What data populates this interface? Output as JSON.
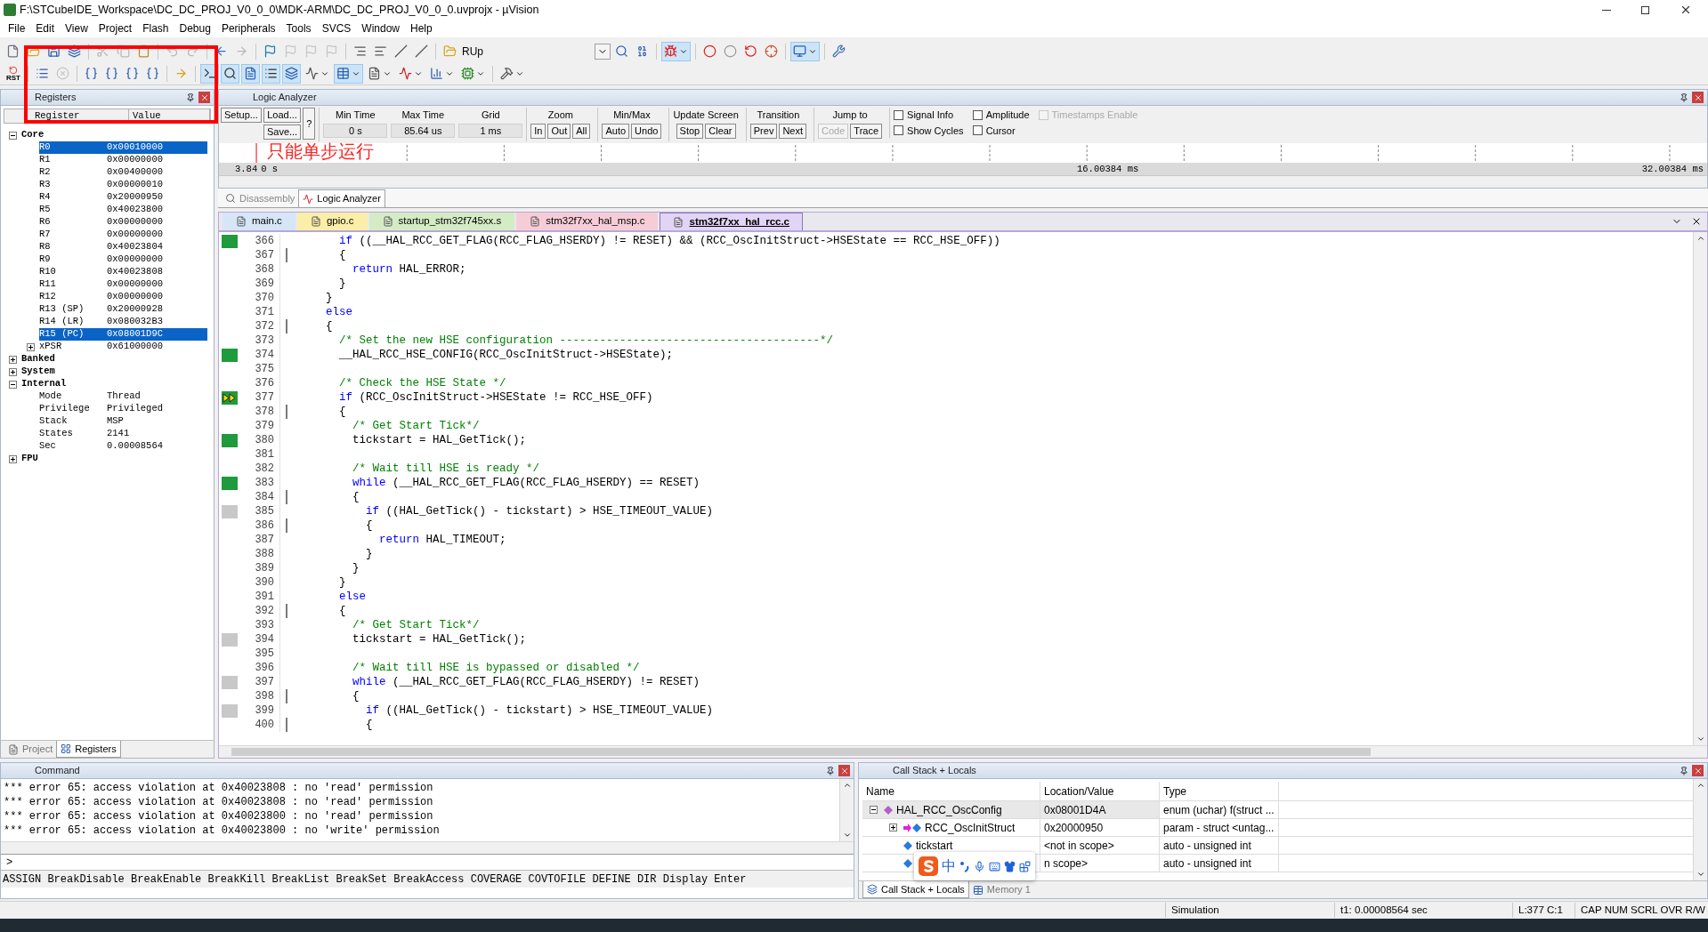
{
  "window": {
    "title": "F:\\STCubeIDE_Workspace\\DC_DC_PROJ_V0_0_0\\MDK-ARM\\DC_DC_PROJ_V0_0_0.uvprojx - µVision"
  },
  "menu": [
    "File",
    "Edit",
    "View",
    "Project",
    "Flash",
    "Debug",
    "Peripherals",
    "Tools",
    "SVCS",
    "Window",
    "Help"
  ],
  "toolbar_1": [
    {
      "kind": "button",
      "selected": false,
      "disabled": false
    },
    {
      "kind": "button",
      "selected": false,
      "disabled": false
    },
    {
      "kind": "button",
      "selected": false,
      "disabled": false
    },
    {
      "kind": "button",
      "selected": false,
      "disabled": false
    },
    {
      "kind": "separator"
    },
    {
      "kind": "button",
      "selected": false,
      "disabled": true
    },
    {
      "kind": "button",
      "selected": false,
      "disabled": true
    },
    {
      "kind": "button",
      "selected": false,
      "disabled": false
    },
    {
      "kind": "separator"
    },
    {
      "kind": "button",
      "selected": false,
      "disabled": true
    },
    {
      "kind": "button",
      "selected": false,
      "disabled": true
    },
    {
      "kind": "separator"
    },
    {
      "kind": "button",
      "selected": false,
      "disabled": false
    },
    {
      "kind": "button",
      "selected": false,
      "disabled": true
    },
    {
      "kind": "separator"
    },
    {
      "kind": "button",
      "selected": false,
      "disabled": false
    },
    {
      "kind": "button",
      "selected": false,
      "disabled": true
    },
    {
      "kind": "button",
      "selected": false,
      "disabled": true
    },
    {
      "kind": "button",
      "selected": false,
      "disabled": true
    },
    {
      "kind": "separator"
    },
    {
      "kind": "button",
      "selected": false,
      "disabled": false
    },
    {
      "kind": "button",
      "selected": false,
      "disabled": false
    },
    {
      "kind": "button",
      "selected": false,
      "disabled": false
    },
    {
      "kind": "button",
      "selected": false,
      "disabled": false
    },
    {
      "kind": "separator"
    },
    {
      "kind": "button",
      "selected": false,
      "disabled": false,
      "label": "RUp"
    },
    {
      "kind": "combo"
    },
    {
      "kind": "button",
      "selected": false,
      "disabled": false
    },
    {
      "kind": "button",
      "selected": false,
      "disabled": false
    },
    {
      "kind": "separator"
    },
    {
      "kind": "split",
      "selected": true,
      "disabled": false
    },
    {
      "kind": "separator"
    },
    {
      "kind": "button",
      "selected": false,
      "disabled": false
    },
    {
      "kind": "button",
      "selected": false,
      "disabled": false
    },
    {
      "kind": "button",
      "selected": false,
      "disabled": false
    },
    {
      "kind": "button",
      "selected": false,
      "disabled": false
    },
    {
      "kind": "separator"
    },
    {
      "kind": "split",
      "selected": true,
      "disabled": false
    },
    {
      "kind": "separator"
    },
    {
      "kind": "button",
      "selected": false,
      "disabled": false
    }
  ],
  "toolbar_2": [
    {
      "kind": "button",
      "selected": false,
      "disabled": false,
      "label": "RST"
    },
    {
      "kind": "separator"
    },
    {
      "kind": "button",
      "selected": false,
      "disabled": false
    },
    {
      "kind": "button",
      "selected": false,
      "disabled": true
    },
    {
      "kind": "separator"
    },
    {
      "kind": "button",
      "selected": false,
      "disabled": false
    },
    {
      "kind": "button",
      "selected": false,
      "disabled": false
    },
    {
      "kind": "button",
      "selected": false,
      "disabled": false
    },
    {
      "kind": "button",
      "selected": false,
      "disabled": false
    },
    {
      "kind": "separator"
    },
    {
      "kind": "button",
      "selected": false,
      "disabled": false
    },
    {
      "kind": "separator"
    },
    {
      "kind": "button",
      "selected": true,
      "disabled": false
    },
    {
      "kind": "button",
      "selected": true,
      "disabled": false
    },
    {
      "kind": "button",
      "selected": true,
      "disabled": false
    },
    {
      "kind": "button",
      "selected": true,
      "disabled": false
    },
    {
      "kind": "button",
      "selected": true,
      "disabled": false
    },
    {
      "kind": "split",
      "selected": false,
      "disabled": false
    },
    {
      "kind": "split",
      "selected": true,
      "disabled": false
    },
    {
      "kind": "split",
      "selected": false,
      "disabled": false
    },
    {
      "kind": "split",
      "selected": false,
      "disabled": false
    },
    {
      "kind": "split",
      "selected": false,
      "disabled": false
    },
    {
      "kind": "split",
      "selected": false,
      "disabled": false
    },
    {
      "kind": "separator"
    },
    {
      "kind": "split",
      "selected": false,
      "disabled": false
    }
  ],
  "registers_panel": {
    "title": "Registers",
    "columns": [
      "Register",
      "Value"
    ],
    "tree": [
      {
        "name": "Core",
        "expanded": true,
        "selected": false,
        "children": [
          {
            "name": "R0",
            "value": "0x00010000",
            "selected": true
          },
          {
            "name": "R1",
            "value": "0x00000000",
            "selected": false
          },
          {
            "name": "R2",
            "value": "0x00400000",
            "selected": false
          },
          {
            "name": "R3",
            "value": "0x00000010",
            "selected": false
          },
          {
            "name": "R4",
            "value": "0x20000950",
            "selected": false
          },
          {
            "name": "R5",
            "value": "0x40023800",
            "selected": false
          },
          {
            "name": "R6",
            "value": "0x00000000",
            "selected": false
          },
          {
            "name": "R7",
            "value": "0x00000000",
            "selected": false
          },
          {
            "name": "R8",
            "value": "0x40023804",
            "selected": false
          },
          {
            "name": "R9",
            "value": "0x00000000",
            "selected": false
          },
          {
            "name": "R10",
            "value": "0x40023808",
            "selected": false
          },
          {
            "name": "R11",
            "value": "0x00000000",
            "selected": false
          },
          {
            "name": "R12",
            "value": "0x00000000",
            "selected": false
          },
          {
            "name": "R13 (SP)",
            "value": "0x20000928",
            "selected": false
          },
          {
            "name": "R14 (LR)",
            "value": "0x080032B3",
            "selected": false
          },
          {
            "name": "R15 (PC)",
            "value": "0x08001D9C",
            "selected": true
          },
          {
            "name": "xPSR",
            "value": "0x61000000",
            "expanded": false,
            "selected": false
          }
        ]
      },
      {
        "name": "Banked",
        "expanded": false,
        "selected": false
      },
      {
        "name": "System",
        "expanded": false,
        "selected": false
      },
      {
        "name": "Internal",
        "expanded": true,
        "selected": false,
        "children": [
          {
            "name": "Mode",
            "value": "Thread",
            "selected": false
          },
          {
            "name": "Privilege",
            "value": "Privileged",
            "selected": false
          },
          {
            "name": "Stack",
            "value": "MSP",
            "selected": false
          },
          {
            "name": "States",
            "value": "2141",
            "selected": false
          },
          {
            "name": "Sec",
            "value": "0.00008564",
            "selected": false
          }
        ]
      },
      {
        "name": "FPU",
        "expanded": false,
        "selected": false
      }
    ],
    "tabs": [
      {
        "label": "Project",
        "selected": false
      },
      {
        "label": "Registers",
        "selected": true
      }
    ]
  },
  "logic_analyzer": {
    "title": "Logic Analyzer",
    "setup_buttons": [
      "Setup...",
      "Load...",
      "Save...",
      "?"
    ],
    "fields": [
      {
        "label": "Min Time",
        "value": "0 s"
      },
      {
        "label": "Max Time",
        "value": "85.64 us"
      },
      {
        "label": "Grid",
        "value": "1 ms"
      }
    ],
    "groups": [
      {
        "label": "Zoom",
        "buttons": [
          {
            "label": "In",
            "disabled": false
          },
          {
            "label": "Out",
            "disabled": false
          },
          {
            "label": "All",
            "disabled": false
          }
        ]
      },
      {
        "label": "Min/Max",
        "buttons": [
          {
            "label": "Auto",
            "disabled": false
          },
          {
            "label": "Undo",
            "disabled": false
          }
        ]
      },
      {
        "label": "Update Screen",
        "buttons": [
          {
            "label": "Stop",
            "disabled": false
          },
          {
            "label": "Clear",
            "disabled": false
          }
        ]
      },
      {
        "label": "Transition",
        "buttons": [
          {
            "label": "Prev",
            "disabled": false
          },
          {
            "label": "Next",
            "disabled": false
          }
        ]
      },
      {
        "label": "Jump to",
        "buttons": [
          {
            "label": "Code",
            "disabled": true
          },
          {
            "label": "Trace",
            "disabled": false
          }
        ]
      }
    ],
    "checkboxes": [
      {
        "label": "Signal Info",
        "checked": false,
        "disabled": false
      },
      {
        "label": "Show Cycles",
        "checked": false,
        "disabled": false
      },
      {
        "label": "Amplitude",
        "checked": false,
        "disabled": false
      },
      {
        "label": "Cursor",
        "checked": false,
        "disabled": false
      },
      {
        "label": "Timestamps Enable",
        "checked": false,
        "disabled": true
      }
    ],
    "axis_labels": [
      "3.84",
      "0 s",
      "16.00384 ms",
      "32.00384 ms"
    ]
  },
  "view_tabs": [
    {
      "label": "Disassembly",
      "selected": false
    },
    {
      "label": "Logic Analyzer",
      "selected": true
    }
  ],
  "editor_tabs": [
    {
      "label": "main.c",
      "selected": false,
      "color": "#d6e6f7"
    },
    {
      "label": "gpio.c",
      "selected": false,
      "color": "#fbeea8"
    },
    {
      "label": "startup_stm32f745xx.s",
      "selected": false,
      "color": "#d4ecc4"
    },
    {
      "label": "stm32f7xx_hal_msp.c",
      "selected": false,
      "color": "#f6cdd6"
    },
    {
      "label": "stm32f7xx_hal_rcc.c",
      "selected": true,
      "color": "#e2d4f4"
    }
  ],
  "code_lines": [
    {
      "number": "366",
      "kind": "executed",
      "fold": false,
      "segments": [
        {
          "kind": "kw",
          "text": "      if"
        },
        {
          "kind": "plain",
          "text": " ((__HAL_RCC_GET_FLAG(RCC_FLAG_HSERDY) != RESET) && (RCC_OscInitStruct->HSEState == RCC_HSE_OFF))"
        }
      ]
    },
    {
      "number": "367",
      "kind": "plain",
      "fold": true,
      "segments": [
        {
          "kind": "plain",
          "text": "      {"
        }
      ]
    },
    {
      "number": "368",
      "kind": "plain",
      "fold": false,
      "segments": [
        {
          "kind": "kw",
          "text": "        return"
        },
        {
          "kind": "plain",
          "text": " HAL_ERROR;"
        }
      ]
    },
    {
      "number": "369",
      "kind": "plain",
      "fold": false,
      "segments": [
        {
          "kind": "plain",
          "text": "      }"
        }
      ]
    },
    {
      "number": "370",
      "kind": "plain",
      "fold": false,
      "segments": [
        {
          "kind": "plain",
          "text": "    }"
        }
      ]
    },
    {
      "number": "371",
      "kind": "plain",
      "fold": false,
      "segments": [
        {
          "kind": "kw",
          "text": "    else"
        }
      ]
    },
    {
      "number": "372",
      "kind": "plain",
      "fold": true,
      "segments": [
        {
          "kind": "plain",
          "text": "    {"
        }
      ]
    },
    {
      "number": "373",
      "kind": "plain",
      "fold": false,
      "segments": [
        {
          "kind": "comment",
          "text": "      /* Set the new HSE configuration ---------------------------------------*/"
        }
      ]
    },
    {
      "number": "374",
      "kind": "executed",
      "fold": false,
      "segments": [
        {
          "kind": "plain",
          "text": "      __HAL_RCC_HSE_CONFIG(RCC_OscInitStruct->HSEState);"
        }
      ]
    },
    {
      "number": "375",
      "kind": "plain",
      "fold": false
    },
    {
      "number": "376",
      "kind": "plain",
      "fold": false,
      "segments": [
        {
          "kind": "comment",
          "text": "      /* Check the HSE State */"
        }
      ]
    },
    {
      "number": "377",
      "kind": "current",
      "fold": false,
      "segments": [
        {
          "kind": "kw",
          "text": "      if"
        },
        {
          "kind": "plain",
          "text": " (RCC_OscInitStruct->HSEState != RCC_HSE_OFF)"
        }
      ]
    },
    {
      "number": "378",
      "kind": "plain",
      "fold": true,
      "segments": [
        {
          "kind": "plain",
          "text": "      {"
        }
      ]
    },
    {
      "number": "379",
      "kind": "plain",
      "fold": false,
      "segments": [
        {
          "kind": "comment",
          "text": "        /* Get Start Tick*/"
        }
      ]
    },
    {
      "number": "380",
      "kind": "executed",
      "fold": false,
      "segments": [
        {
          "kind": "plain",
          "text": "        tickstart = HAL_GetTick();"
        }
      ]
    },
    {
      "number": "381",
      "kind": "plain",
      "fold": false
    },
    {
      "number": "382",
      "kind": "plain",
      "fold": false,
      "segments": [
        {
          "kind": "comment",
          "text": "        /* Wait till HSE is ready */"
        }
      ]
    },
    {
      "number": "383",
      "kind": "executed",
      "fold": false,
      "segments": [
        {
          "kind": "kw",
          "text": "        while"
        },
        {
          "kind": "plain",
          "text": " (__HAL_RCC_GET_FLAG(RCC_FLAG_HSERDY) == RESET)"
        }
      ]
    },
    {
      "number": "384",
      "kind": "plain",
      "fold": true,
      "segments": [
        {
          "kind": "plain",
          "text": "        {"
        }
      ]
    },
    {
      "number": "385",
      "kind": "not-executed",
      "fold": false,
      "segments": [
        {
          "kind": "kw",
          "text": "          if"
        },
        {
          "kind": "plain",
          "text": " ((HAL_GetTick() - tickstart) > HSE_TIMEOUT_VALUE)"
        }
      ]
    },
    {
      "number": "386",
      "kind": "plain",
      "fold": true,
      "segments": [
        {
          "kind": "plain",
          "text": "          {"
        }
      ]
    },
    {
      "number": "387",
      "kind": "plain",
      "fold": false,
      "segments": [
        {
          "kind": "kw",
          "text": "            return"
        },
        {
          "kind": "plain",
          "text": " HAL_TIMEOUT;"
        }
      ]
    },
    {
      "number": "388",
      "kind": "plain",
      "fold": false,
      "segments": [
        {
          "kind": "plain",
          "text": "          }"
        }
      ]
    },
    {
      "number": "389",
      "kind": "plain",
      "fold": false,
      "segments": [
        {
          "kind": "plain",
          "text": "        }"
        }
      ]
    },
    {
      "number": "390",
      "kind": "plain",
      "fold": false,
      "segments": [
        {
          "kind": "plain",
          "text": "      }"
        }
      ]
    },
    {
      "number": "391",
      "kind": "plain",
      "fold": false,
      "segments": [
        {
          "kind": "kw",
          "text": "      else"
        }
      ]
    },
    {
      "number": "392",
      "kind": "plain",
      "fold": true,
      "segments": [
        {
          "kind": "plain",
          "text": "      {"
        }
      ]
    },
    {
      "number": "393",
      "kind": "plain",
      "fold": false,
      "segments": [
        {
          "kind": "comment",
          "text": "        /* Get Start Tick*/"
        }
      ]
    },
    {
      "number": "394",
      "kind": "not-executed",
      "fold": false,
      "segments": [
        {
          "kind": "plain",
          "text": "        tickstart = HAL_GetTick();"
        }
      ]
    },
    {
      "number": "395",
      "kind": "plain",
      "fold": false
    },
    {
      "number": "396",
      "kind": "plain",
      "fold": false,
      "segments": [
        {
          "kind": "comment",
          "text": "        /* Wait till HSE is bypassed or disabled */"
        }
      ]
    },
    {
      "number": "397",
      "kind": "not-executed",
      "fold": false,
      "segments": [
        {
          "kind": "kw",
          "text": "        while"
        },
        {
          "kind": "plain",
          "text": " (__HAL_RCC_GET_FLAG(RCC_FLAG_HSERDY) != RESET)"
        }
      ]
    },
    {
      "number": "398",
      "kind": "plain",
      "fold": true,
      "segments": [
        {
          "kind": "plain",
          "text": "        {"
        }
      ]
    },
    {
      "number": "399",
      "kind": "not-executed",
      "fold": false,
      "segments": [
        {
          "kind": "kw",
          "text": "          if"
        },
        {
          "kind": "plain",
          "text": " ((HAL_GetTick() - tickstart) > HSE_TIMEOUT_VALUE)"
        }
      ]
    },
    {
      "number": "400",
      "kind": "plain",
      "fold": true,
      "segments": [
        {
          "kind": "plain",
          "text": "          {"
        }
      ]
    }
  ],
  "command_panel": {
    "title": "Command",
    "output": [
      "*** error 65: access violation at 0x40023808 : no 'read' permission",
      "*** error 65: access violation at 0x40023808 : no 'read' permission",
      "*** error 65: access violation at 0x40023800 : no 'read' permission",
      "*** error 65: access violation at 0x40023800 : no 'write' permission"
    ],
    "prompt": ">",
    "hints": "ASSIGN BreakDisable BreakEnable BreakKill BreakList BreakSet BreakAccess COVERAGE COVTOFILE DEFINE DIR Display Enter"
  },
  "call_stack_panel": {
    "title": "Call Stack + Locals",
    "columns": [
      "Name",
      "Location/Value",
      "Type"
    ],
    "rows": [
      {
        "kind": "function",
        "name": "HAL_RCC_OscConfig",
        "value": "0x08001D4A",
        "type": "enum (uchar) f(struct ...",
        "expanded": true,
        "selected": true,
        "children": [
          {
            "kind": "param",
            "name": "RCC_OscInitStruct",
            "value": "0x20000950",
            "type": "param - struct <untag...",
            "expanded": false,
            "selected": false
          },
          {
            "kind": "variable",
            "name": "tickstart",
            "value": "<not in scope>",
            "type": "auto - unsigned int",
            "selected": false
          },
          {
            "kind": "variable",
            "value": "n scope>",
            "type": "auto - unsigned int",
            "selected": false
          }
        ]
      }
    ],
    "tabs": [
      {
        "label": "Call Stack + Locals",
        "selected": true
      },
      {
        "label": "Memory 1",
        "selected": false
      }
    ]
  },
  "ime_toolbar": {
    "label": "中"
  },
  "status_bar": {
    "mode": "Simulation",
    "time": "t1: 0.00008564 sec",
    "position": "L:377 C:1",
    "keys": "CAP NUM SCRL OVR R/W"
  },
  "annotation": {
    "text": "只能单步运行"
  }
}
